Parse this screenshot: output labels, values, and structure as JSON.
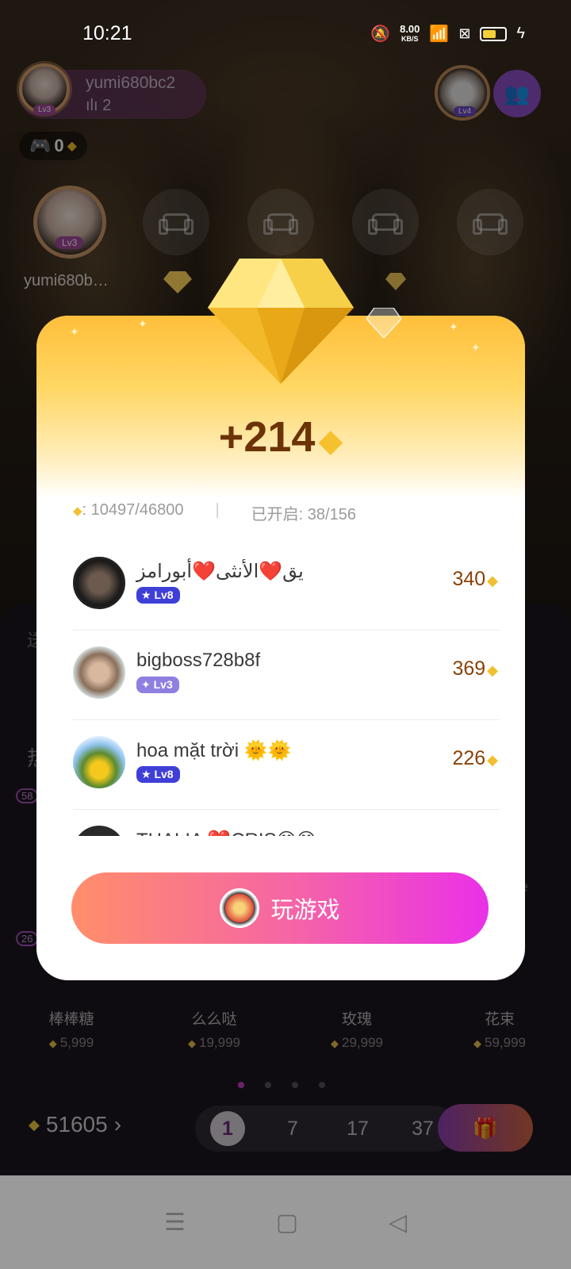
{
  "status_bar": {
    "time": "10:21",
    "net_speed": "8.00",
    "net_unit": "KB/S"
  },
  "host": {
    "name": "yumi680bc2",
    "level": "Lv3",
    "listeners": "2"
  },
  "game_chip": {
    "count": "0"
  },
  "top_right": {
    "level": "Lv4"
  },
  "seats": {
    "host_name": "yumi680b…",
    "host_level": "Lv3"
  },
  "modal": {
    "reward": "+214",
    "progress_amount": ": 10497/46800",
    "opened": "已开启: 38/156",
    "rows": [
      {
        "name": "يق❤️الأنثى❤️أبورامز",
        "level": "Lv8",
        "amount": "340"
      },
      {
        "name": "bigboss728b8f",
        "level": "Lv3",
        "amount": "369"
      },
      {
        "name": "hoa mặt trời 🌞🌞",
        "level": "Lv8",
        "amount": "226"
      },
      {
        "name": "THALIA ❤️CRIS😊😊",
        "level": "",
        "amount": ""
      }
    ],
    "play_button": "玩游戏"
  },
  "gift_panel": {
    "gifts": [
      {
        "name": "棒棒糖",
        "price": "5,999"
      },
      {
        "name": "么么哒",
        "price": "19,999"
      },
      {
        "name": "玫瑰",
        "price": "29,999"
      },
      {
        "name": "花束",
        "price": "59,999"
      }
    ],
    "balance": "51605",
    "quantities": [
      "1",
      "7",
      "17",
      "37"
    ],
    "badge_1": "58",
    "badge_2": "26",
    "side_left_1": "送",
    "side_left_2": "热",
    "side_right": "e"
  },
  "colors": {
    "accent": "#ea30e8",
    "gold": "#f5c12e",
    "reward_text": "#6c3208"
  }
}
